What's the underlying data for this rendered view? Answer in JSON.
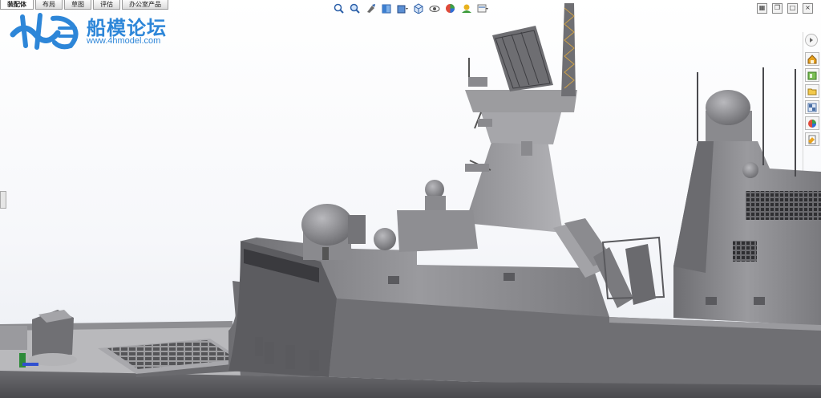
{
  "tabs": [
    "装配体",
    "布局",
    "草图",
    "评估",
    "办公室产品"
  ],
  "active_tab": "装配体",
  "watermark": {
    "name": "船模论坛",
    "url": "www.4hmodel.com"
  },
  "hud_icons": [
    "zoom-to-fit-icon",
    "zoom-area-icon",
    "previous-view-icon",
    "section-view-icon",
    "display-style-icon",
    "view-orientation-icon",
    "hide-show-icon",
    "edit-appearance-icon",
    "apply-scene-icon",
    "view-settings-icon"
  ],
  "window_icons": [
    "tile-icon",
    "restore-icon",
    "maximize-icon",
    "close-icon"
  ],
  "task_pane_icons": [
    "resources-icon",
    "design-library-icon",
    "file-explorer-icon",
    "view-palette-icon",
    "appearances-icon",
    "custom-properties-icon"
  ],
  "colors": {
    "hull": "#5e5e62",
    "superstructure": "#8a8a8e",
    "deck": "#6a6a6e",
    "logo_blue": "#2d86d8",
    "background": "#f6f7fa"
  }
}
